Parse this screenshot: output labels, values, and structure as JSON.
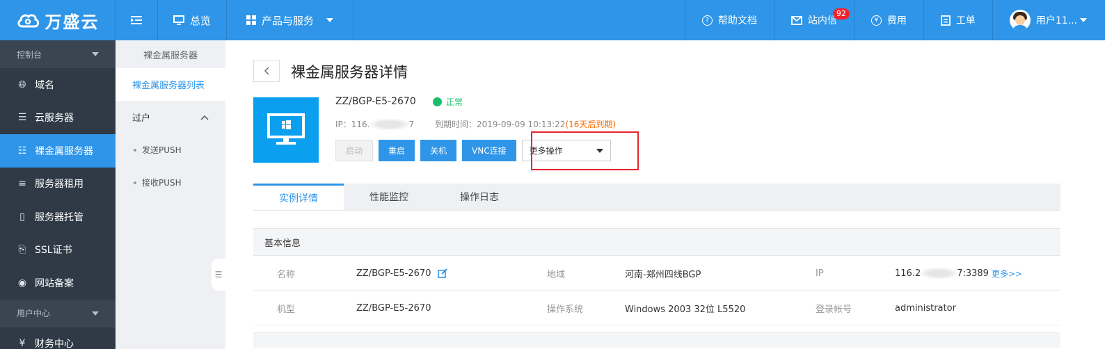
{
  "brand": {
    "name": "万盛云"
  },
  "topnav": {
    "overview": "总览",
    "products": "产品与服务",
    "help": "帮助文档",
    "messages": "站内信",
    "messages_count": "92",
    "fees": "费用",
    "tickets": "工单",
    "user": "用户11..."
  },
  "sidebar": {
    "group1": "控制台",
    "items": [
      "域名",
      "云服务器",
      "裸金属服务器",
      "服务器租用",
      "服务器托管",
      "SSL证书",
      "网站备案"
    ],
    "group2": "用户中心",
    "partial_item": "财务中心"
  },
  "subnav": {
    "header": "裸金属服务器",
    "active": "裸金属服务器列表",
    "group": "过户",
    "sub_items": [
      "发送PUSH",
      "接收PUSH"
    ]
  },
  "page": {
    "title": "裸金属服务器详情",
    "server_name": "ZZ/BGP-E5-2670",
    "status": "正常",
    "ip_prefix": "IP：116.",
    "ip_suffix": "7",
    "expire_label": "到期时间：2019-09-09 10:13:22",
    "expire_warn": "(16天后到期)",
    "buttons": {
      "start": "启动",
      "restart": "重启",
      "shutdown": "关机",
      "vnc": "VNC连接"
    },
    "more_ops": "更多操作"
  },
  "tabs": [
    "实例详情",
    "性能监控",
    "操作日志"
  ],
  "info": {
    "section_title": "基本信息",
    "row1": {
      "name_label": "名称",
      "name_value": "ZZ/BGP-E5-2670",
      "region_label": "地域",
      "region_value": "河南-郑州四线BGP",
      "ip_label": "IP",
      "ip_prefix": "116.2",
      "ip_suffix": "7:3389",
      "more_link": "更多>>"
    },
    "row2": {
      "model_label": "机型",
      "model_value": "ZZ/BGP-E5-2670",
      "os_label": "操作系统",
      "os_value": "Windows 2003 32位 L5520",
      "login_label": "登录帐号",
      "login_value": "administrator"
    }
  },
  "colors": {
    "primary": "#2e95e8",
    "sidebar": "#2f3a46",
    "success": "#19be6b",
    "warning": "#ff6a00",
    "highlight": "#e8262d"
  }
}
